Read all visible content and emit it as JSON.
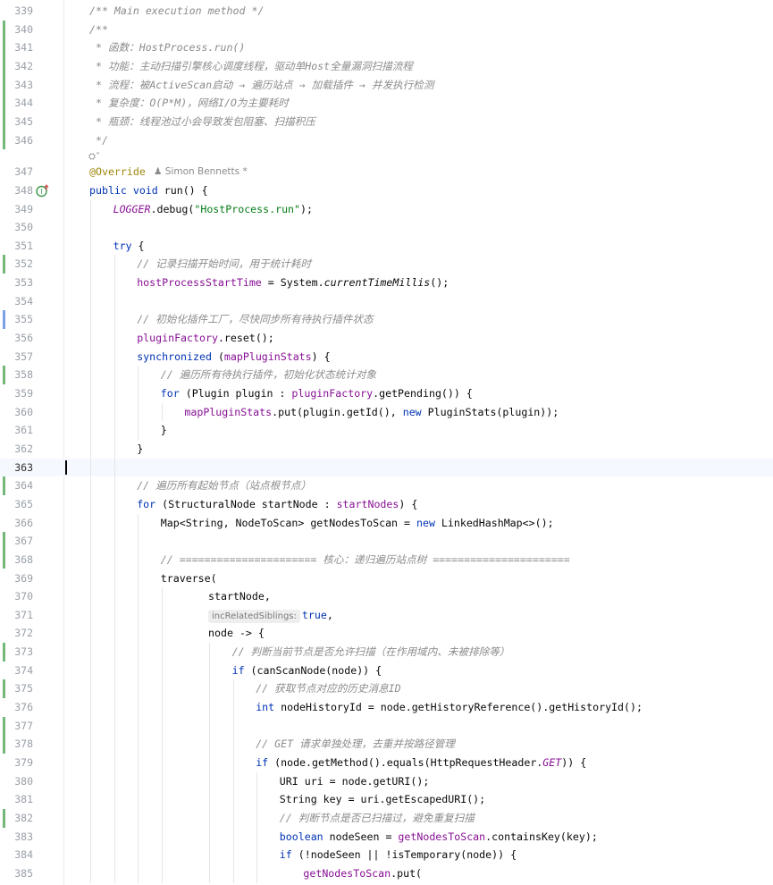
{
  "editor": {
    "author": "Simon Bennetts *",
    "inline_hint": "incRelatedSiblings:",
    "current_line": 363,
    "lines": [
      {
        "n": 339,
        "indent": 0,
        "parts": [
          [
            "cmt",
            "/** Main execution method */"
          ]
        ]
      },
      {
        "n": 340,
        "indent": 0,
        "parts": [
          [
            "cmt",
            "/**"
          ]
        ]
      },
      {
        "n": 341,
        "indent": 0,
        "parts": [
          [
            "cmt",
            " * 函数：HostProcess.run()"
          ]
        ]
      },
      {
        "n": 342,
        "indent": 0,
        "parts": [
          [
            "cmt",
            " * 功能：主动扫描引擎核心调度线程，驱动单Host全量漏洞扫描流程"
          ]
        ]
      },
      {
        "n": 343,
        "indent": 0,
        "parts": [
          [
            "cmt",
            " * 流程：被ActiveScan启动 → 遍历站点 → 加载插件 → 并发执行检测"
          ]
        ]
      },
      {
        "n": 344,
        "indent": 0,
        "parts": [
          [
            "cmt",
            " * 复杂度：O(P*M)，网络I/O为主要耗时"
          ]
        ]
      },
      {
        "n": 345,
        "indent": 0,
        "parts": [
          [
            "cmt",
            " * 瓶颈：线程池过小会导致发包阻塞、扫描积压"
          ]
        ]
      },
      {
        "n": 346,
        "indent": 0,
        "parts": [
          [
            "cmt",
            " */"
          ]
        ]
      },
      {
        "n": 347,
        "indent": 0,
        "parts": [
          [
            "ann",
            "@Override"
          ]
        ]
      },
      {
        "n": 348,
        "indent": 0,
        "parts": [
          [
            "kw",
            "public void "
          ],
          [
            "",
            "run() {"
          ]
        ]
      },
      {
        "n": 349,
        "indent": 1,
        "parts": [
          [
            "sfld",
            "LOGGER"
          ],
          [
            "",
            ".debug("
          ],
          [
            "str",
            "\"HostProcess.run\""
          ],
          [
            "",
            ");"
          ]
        ]
      },
      {
        "n": 350,
        "indent": 0,
        "parts": []
      },
      {
        "n": 351,
        "indent": 1,
        "parts": [
          [
            "kw",
            "try "
          ],
          [
            "",
            "{"
          ]
        ]
      },
      {
        "n": 352,
        "indent": 2,
        "parts": [
          [
            "cmt",
            "// 记录扫描开始时间，用于统计耗时"
          ]
        ]
      },
      {
        "n": 353,
        "indent": 2,
        "parts": [
          [
            "fld",
            "hostProcessStartTime"
          ],
          [
            "",
            " = System."
          ],
          [
            "smeth",
            "currentTimeMillis"
          ],
          [
            "",
            "();"
          ]
        ]
      },
      {
        "n": 354,
        "indent": 0,
        "parts": []
      },
      {
        "n": 355,
        "indent": 2,
        "parts": [
          [
            "cmt",
            "// 初始化插件工厂，尽快同步所有待执行插件状态"
          ]
        ]
      },
      {
        "n": 356,
        "indent": 2,
        "parts": [
          [
            "fld",
            "pluginFactory"
          ],
          [
            "",
            ".reset();"
          ]
        ]
      },
      {
        "n": 357,
        "indent": 2,
        "parts": [
          [
            "kw",
            "synchronized "
          ],
          [
            "",
            "("
          ],
          [
            "fld",
            "mapPluginStats"
          ],
          [
            "",
            ") {"
          ]
        ]
      },
      {
        "n": 358,
        "indent": 3,
        "parts": [
          [
            "cmt",
            "// 遍历所有待执行插件，初始化状态统计对象"
          ]
        ]
      },
      {
        "n": 359,
        "indent": 3,
        "parts": [
          [
            "kw",
            "for "
          ],
          [
            "",
            "(Plugin plugin : "
          ],
          [
            "fld",
            "pluginFactory"
          ],
          [
            "",
            ".getPending()) {"
          ]
        ]
      },
      {
        "n": 360,
        "indent": 4,
        "parts": [
          [
            "fld",
            "mapPluginStats"
          ],
          [
            "",
            ".put(plugin.getId(), "
          ],
          [
            "kw",
            "new "
          ],
          [
            "",
            "PluginStats(plugin));"
          ]
        ]
      },
      {
        "n": 361,
        "indent": 3,
        "parts": [
          [
            "",
            "}"
          ]
        ]
      },
      {
        "n": 362,
        "indent": 2,
        "parts": [
          [
            "",
            "}"
          ]
        ]
      },
      {
        "n": 363,
        "indent": 0,
        "parts": []
      },
      {
        "n": 364,
        "indent": 2,
        "parts": [
          [
            "cmt",
            "// 遍历所有起始节点（站点根节点）"
          ]
        ]
      },
      {
        "n": 365,
        "indent": 2,
        "parts": [
          [
            "kw",
            "for "
          ],
          [
            "",
            "(StructuralNode startNode : "
          ],
          [
            "fld",
            "startNodes"
          ],
          [
            "",
            ") {"
          ]
        ]
      },
      {
        "n": 366,
        "indent": 3,
        "parts": [
          [
            "",
            "Map<String, NodeToScan> getNodesToScan = "
          ],
          [
            "kw",
            "new "
          ],
          [
            "",
            "LinkedHashMap<>();"
          ]
        ]
      },
      {
        "n": 367,
        "indent": 0,
        "parts": []
      },
      {
        "n": 368,
        "indent": 3,
        "parts": [
          [
            "cmt",
            "// ====================== 核心：递归遍历站点树 ======================"
          ]
        ]
      },
      {
        "n": 369,
        "indent": 3,
        "parts": [
          [
            "",
            "traverse("
          ]
        ]
      },
      {
        "n": 370,
        "indent": 5,
        "parts": [
          [
            "",
            "startNode,"
          ]
        ]
      },
      {
        "n": 371,
        "indent": 5,
        "parts": [
          [
            "hint",
            ""
          ],
          [
            "kw",
            "true"
          ],
          [
            "",
            ","
          ]
        ]
      },
      {
        "n": 372,
        "indent": 5,
        "parts": [
          [
            "",
            "node -> {"
          ]
        ]
      },
      {
        "n": 373,
        "indent": 6,
        "parts": [
          [
            "cmt",
            "// 判断当前节点是否允许扫描（在作用域内、未被排除等）"
          ]
        ]
      },
      {
        "n": 374,
        "indent": 6,
        "parts": [
          [
            "kw",
            "if "
          ],
          [
            "",
            "(canScanNode(node)) {"
          ]
        ]
      },
      {
        "n": 375,
        "indent": 7,
        "parts": [
          [
            "cmt",
            "// 获取节点对应的历史消息ID"
          ]
        ]
      },
      {
        "n": 376,
        "indent": 7,
        "parts": [
          [
            "kw",
            "int "
          ],
          [
            "",
            "nodeHistoryId = node.getHistoryReference().getHistoryId();"
          ]
        ]
      },
      {
        "n": 377,
        "indent": 0,
        "parts": []
      },
      {
        "n": 378,
        "indent": 7,
        "parts": [
          [
            "cmt",
            "// GET 请求单独处理，去重并按路径管理"
          ]
        ]
      },
      {
        "n": 379,
        "indent": 7,
        "parts": [
          [
            "kw",
            "if "
          ],
          [
            "",
            "(node.getMethod().equals(HttpRequestHeader."
          ],
          [
            "sfld",
            "GET"
          ],
          [
            "",
            ")) {"
          ]
        ]
      },
      {
        "n": 380,
        "indent": 8,
        "parts": [
          [
            "",
            "URI uri = node.getURI();"
          ]
        ]
      },
      {
        "n": 381,
        "indent": 8,
        "parts": [
          [
            "",
            "String key = uri.getEscapedURI();"
          ]
        ]
      },
      {
        "n": 382,
        "indent": 8,
        "parts": [
          [
            "cmt",
            "// 判断节点是否已扫描过，避免重复扫描"
          ]
        ]
      },
      {
        "n": 383,
        "indent": 8,
        "parts": [
          [
            "kw",
            "boolean "
          ],
          [
            "",
            "nodeSeen = "
          ],
          [
            "fld",
            "getNodesToScan"
          ],
          [
            "",
            ".containsKey(key);"
          ]
        ]
      },
      {
        "n": 384,
        "indent": 8,
        "parts": [
          [
            "kw",
            "if "
          ],
          [
            "",
            "(!nodeSeen || !isTemporary(node)) {"
          ]
        ]
      },
      {
        "n": 385,
        "indent": 9,
        "parts": [
          [
            "fld",
            "getNodesToScan"
          ],
          [
            "",
            ".put("
          ]
        ]
      }
    ]
  },
  "colors": {
    "keyword": "#0033b3",
    "field": "#871094",
    "string": "#067d17",
    "comment": "#8c8c8c",
    "annotation": "#9e880d",
    "vcs_added": "#74b77a",
    "vcs_modified": "#7aa0e6"
  },
  "icons": [
    "override-run-icon",
    "code-lens-icon"
  ]
}
